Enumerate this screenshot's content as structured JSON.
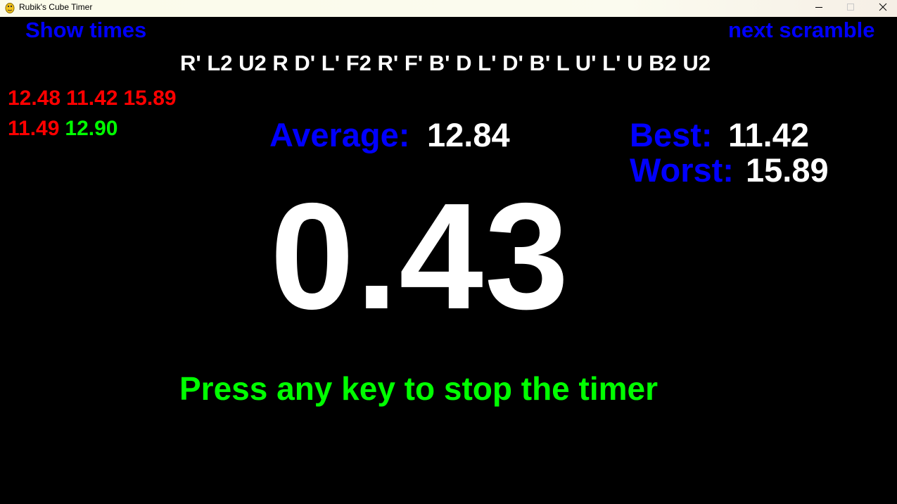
{
  "window": {
    "title": "Rubik's Cube Timer",
    "icon": "python-icon"
  },
  "header": {
    "show_times_label": "Show times",
    "next_scramble_label": "next scramble"
  },
  "scramble": "R' L2 U2 R D' L' F2 R' F' B' D L' D' B' L U' L' U B2 U2",
  "times": [
    {
      "value": "12.48",
      "color": "#ff0000"
    },
    {
      "value": "11.42",
      "color": "#ff0000"
    },
    {
      "value": "15.89",
      "color": "#ff0000"
    },
    {
      "value": "11.49",
      "color": "#ff0000"
    },
    {
      "value": "12.90",
      "color": "#00ff00"
    }
  ],
  "stats": {
    "average_label": "Average:",
    "average_value": "12.84",
    "best_label": "Best:",
    "best_value": "11.42",
    "worst_label": "Worst:",
    "worst_value": "15.89"
  },
  "timer": "0.43",
  "prompt": "Press any key to stop the timer",
  "colors": {
    "background": "#000000",
    "label_blue": "#0000ff",
    "value_white": "#ffffff",
    "time_red": "#ff0000",
    "time_green": "#00ff00"
  }
}
